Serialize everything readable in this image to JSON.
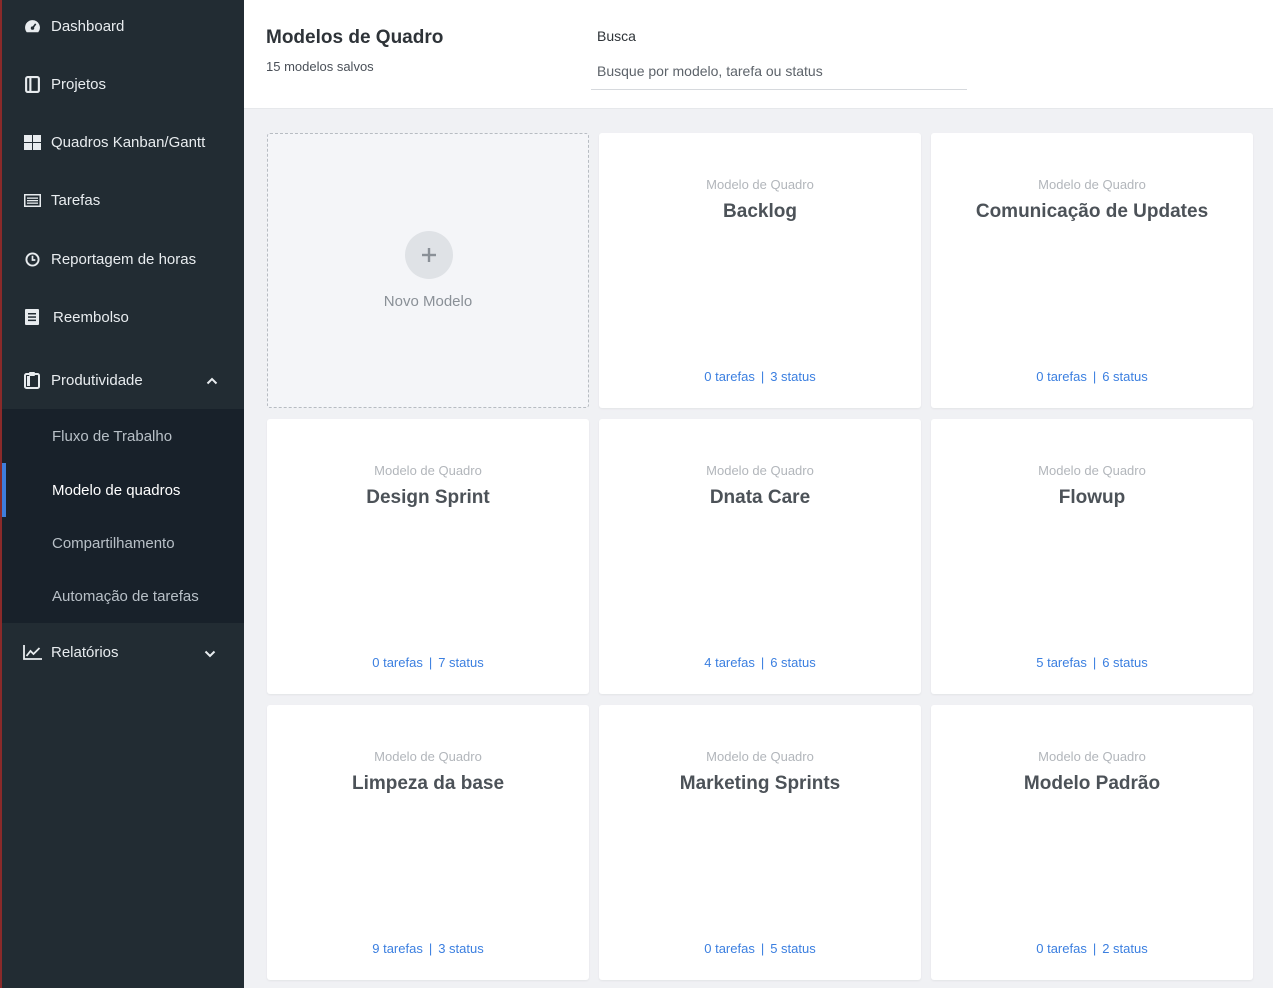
{
  "sidebar": {
    "items": [
      {
        "label": "Dashboard",
        "icon": "dashboard-gauge-icon"
      },
      {
        "label": "Projetos",
        "icon": "book-icon"
      },
      {
        "label": "Quadros Kanban/Gantt",
        "icon": "grid-icon"
      },
      {
        "label": "Tarefas",
        "icon": "list-icon"
      },
      {
        "label": "Reportagem de horas",
        "icon": "clock-icon"
      },
      {
        "label": "Reembolso",
        "icon": "document-icon"
      },
      {
        "label": "Produtividade",
        "icon": "clipboard-icon",
        "expanded": true
      },
      {
        "label": "Relatórios",
        "icon": "line-chart-icon",
        "expanded": false
      }
    ],
    "submenu": [
      {
        "label": "Fluxo de Trabalho"
      },
      {
        "label": "Modelo de quadros",
        "active": true
      },
      {
        "label": "Compartilhamento"
      },
      {
        "label": "Automação de tarefas"
      }
    ]
  },
  "header": {
    "title": "Modelos de Quadro",
    "subtitle": "15 modelos salvos",
    "search_label": "Busca",
    "search_placeholder": "Busque por modelo, tarefa ou status"
  },
  "new_card": {
    "label": "Novo Modelo"
  },
  "cards": [
    {
      "kicker": "Modelo de Quadro",
      "title": "Backlog",
      "tasks": "0 tarefas",
      "status": "3 status"
    },
    {
      "kicker": "Modelo de Quadro",
      "title": "Comunicação de Updates",
      "tasks": "0 tarefas",
      "status": "6 status"
    },
    {
      "kicker": "Modelo de Quadro",
      "title": "Design Sprint",
      "tasks": "0 tarefas",
      "status": "7 status"
    },
    {
      "kicker": "Modelo de Quadro",
      "title": "Dnata Care",
      "tasks": "4 tarefas",
      "status": "6 status"
    },
    {
      "kicker": "Modelo de Quadro",
      "title": "Flowup",
      "tasks": "5 tarefas",
      "status": "6 status"
    },
    {
      "kicker": "Modelo de Quadro",
      "title": "Limpeza da base",
      "tasks": "9 tarefas",
      "status": "3 status"
    },
    {
      "kicker": "Modelo de Quadro",
      "title": "Marketing Sprints",
      "tasks": "0 tarefas",
      "status": "5 status"
    },
    {
      "kicker": "Modelo de Quadro",
      "title": "Modelo Padrão",
      "tasks": "0 tarefas",
      "status": "2 status"
    }
  ],
  "colors": {
    "sidebar_bg": "#222c33",
    "submenu_bg": "#18212a",
    "active_accent": "#3e7ddb",
    "link": "#3b7fe0",
    "page_bg": "#f0f1f4"
  }
}
